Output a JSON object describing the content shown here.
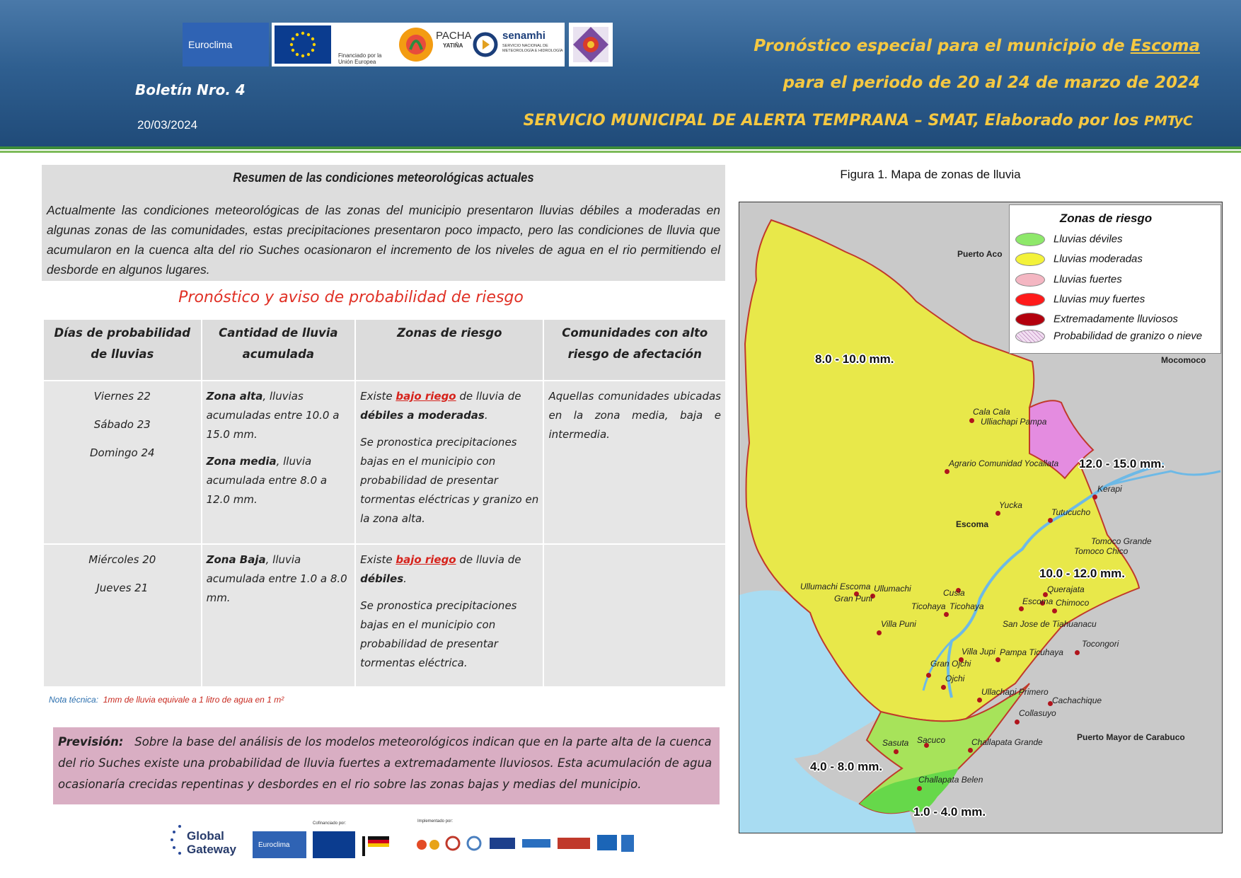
{
  "header": {
    "bulletin": "Boletín Nro. 4",
    "date": "20/03/2024",
    "title_prefix": "Pronóstico especial para el municipio de ",
    "title_municipality": "Escoma",
    "title_period": "para el periodo de 20 al 24 de marzo de 2024",
    "title_service_main": "SERVICIO MUNICIPAL DE ALERTA TEMPRANA – SMAT, Elaborado por los ",
    "title_service_suffix": "PMTyC",
    "logos": {
      "euroclima": "Euroclima",
      "eu_funding": "Financiado por la Unión Europea",
      "pacha": "PACHA",
      "pacha_sub": "YATIÑA",
      "senamhi": "senamhi",
      "senamhi_sub": "SERVICIO NACIONAL DE METEOROLOGÍA E HIDROLOGÍA"
    }
  },
  "summary": {
    "title": "Resumen de las condiciones meteorológicas actuales",
    "body": "Actualmente las condiciones meteorológicas de las zonas del municipio presentaron lluvias débiles a moderadas en algunas zonas de las comunidades, estas precipitaciones presentaron poco impacto, pero las condiciones de lluvia que acumularon en la cuenca alta del rio Suches ocasionaron el incremento de los niveles de agua en el rio permitiendo el desborde en algunos lugares."
  },
  "forecast": {
    "title": "Pronóstico y aviso de probabilidad de riesgo",
    "headers": [
      "Días de probabilidad de lluvias",
      "Cantidad de lluvia acumulada",
      "Zonas de riesgo",
      "Comunidades con alto riesgo de afectación"
    ],
    "rows": [
      {
        "days": [
          "Viernes 22",
          "Sábado 23",
          "Domingo 24"
        ],
        "qty_a_bold": "Zona alta",
        "qty_a_text": ", lluvias acumuladas entre 10.0 a 15.0 mm.",
        "qty_b_bold": "Zona media",
        "qty_b_text": ", lluvia acumulada entre 8.0 a 12.0 mm.",
        "zone_pre": "Existe ",
        "zone_link": "bajo riego",
        "zone_mid": " de lluvia de ",
        "zone_bold": "débiles a moderadas",
        "zone_end": ".",
        "zone_detail": "Se pronostica precipitaciones bajas en el municipio con probabilidad de presentar tormentas eléctricas y granizo en la zona alta.",
        "communities": "Aquellas comunidades ubicadas en la zona media, baja e intermedia."
      },
      {
        "days": [
          "Miércoles 20",
          "Jueves 21"
        ],
        "qty_a_bold": "Zona Baja",
        "qty_a_text": ", lluvia acumulada entre 1.0 a 8.0 mm.",
        "zone_pre": "Existe ",
        "zone_link": "bajo riego",
        "zone_mid": " de lluvia de ",
        "zone_bold": "débiles",
        "zone_end": ".",
        "zone_detail": "Se pronostica precipitaciones bajas en el municipio con probabilidad de presentar tormentas eléctrica.",
        "communities": ""
      }
    ]
  },
  "note": {
    "label": "Nota técnica:",
    "text": "1mm de lluvia equivale a 1 litro de agua en 1 m²"
  },
  "prevision": {
    "label": "Previsión:",
    "text": "Sobre la base del análisis de los modelos meteorológicos indican que en la parte alta de la cuenca del rio Suches existe una probabilidad de lluvia fuertes a extremadamente lluviosos. Esta acumulación de agua ocasionaría crecidas repentinas y desbordes en el rio sobre las zonas bajas y medias del municipio."
  },
  "footer": {
    "global_gateway": "Global Gateway",
    "euroclima": "Euroclima",
    "cofinanced": "Cofinanciado por:",
    "implemented": "Implementado por:"
  },
  "map": {
    "caption": "Figura 1. Mapa de zonas de lluvia",
    "legend_title": "Zonas de riesgo",
    "legend": [
      {
        "label": "Lluvias déviles",
        "color": "#8ee86a"
      },
      {
        "label": "Lluvias moderadas",
        "color": "#f3f23a"
      },
      {
        "label": "Lluvias fuertes",
        "color": "#f4b6c2"
      },
      {
        "label": "Lluvias muy fuertes",
        "color": "#ff1a1a"
      },
      {
        "label": "Extremadamente lluviosos",
        "color": "#b3000d"
      },
      {
        "label": "Probabilidad de granizo o nieve",
        "color": "#e9c8e8"
      }
    ],
    "zones": {
      "z1": "8.0 - 10.0 mm.",
      "z2": "12.0 - 15.0 mm.",
      "z3": "10.0 - 12.0 mm.",
      "z4": "4.0 - 8.0 mm.",
      "z5": "1.0 - 4.0 mm."
    },
    "towns": {
      "puerto_acosta": "Puerto Aco",
      "mocomoco": "Mocomoco",
      "escoma": "Escoma",
      "carabuco": "Puerto Mayor de Carabuco"
    },
    "communities": {
      "c01": "Cala Cala",
      "c02": "Ulliachapi Pampa",
      "c03": "Agrario Comunidad Yocallata",
      "c04": "Kerapi",
      "c05": "Yucka",
      "c06": "Tutucucho",
      "c07": "Tomoco Grande",
      "c08": "Tomoco Chico",
      "c09": "Ullumachi Escoma",
      "c10": "Ullumachi",
      "c11": "Gran Puni",
      "c12": "Cusia",
      "c13": "Ticohaya",
      "c14": "Ticohaya",
      "c15": "Querajata",
      "c16": "Escoma",
      "c17": "Chimoco",
      "c18": "Villa Puni",
      "c19": "San Jose de Tiahuanacu",
      "c20": "Tocongori",
      "c21": "Villa Jupi",
      "c22": "Pampa Ticuhaya",
      "c23": "Gran Ojchi",
      "c24": "Ojchi",
      "c25": "Ullachapi Primero",
      "c26": "Cachachique",
      "c27": "Collasuyo",
      "c28": "Sasuta",
      "c29": "Sacuco",
      "c30": "Challapata Grande",
      "c31": "Challapata Belen"
    }
  }
}
